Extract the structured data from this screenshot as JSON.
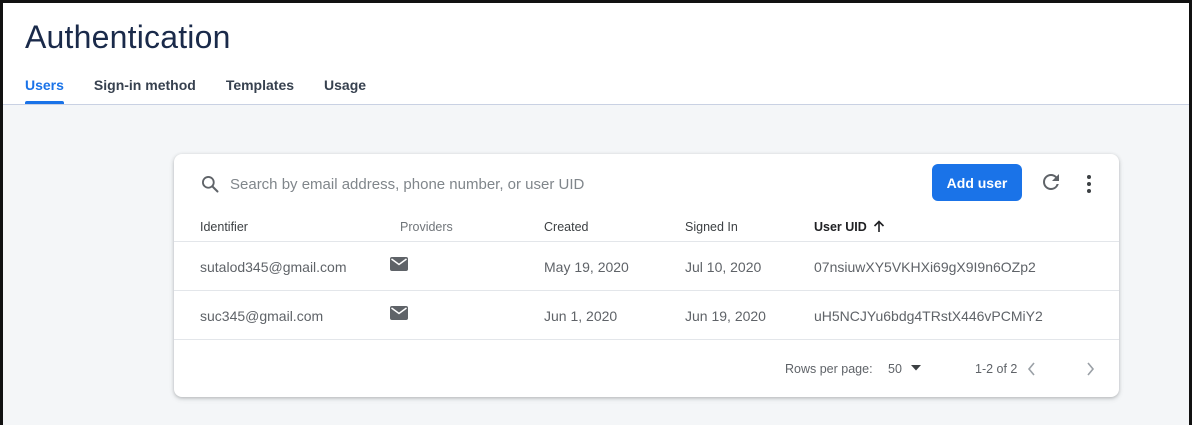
{
  "header": {
    "title": "Authentication",
    "tabs": [
      {
        "label": "Users",
        "active": true
      },
      {
        "label": "Sign-in method",
        "active": false
      },
      {
        "label": "Templates",
        "active": false
      },
      {
        "label": "Usage",
        "active": false
      }
    ]
  },
  "toolbar": {
    "search_placeholder": "Search by email address, phone number, or user UID",
    "add_user_label": "Add user",
    "search_icon": "search-icon",
    "refresh_icon": "refresh-icon",
    "more_icon": "more-vert-icon"
  },
  "table": {
    "columns": [
      "Identifier",
      "Providers",
      "Created",
      "Signed In",
      "User UID"
    ],
    "sort_column": "User UID",
    "sort_direction": "ascending",
    "rows": [
      {
        "identifier": "sutalod345@gmail.com",
        "provider_icon": "mail-icon",
        "created": "May 19, 2020",
        "signed_in": "Jul 10, 2020",
        "uid": "07nsiuwXY5VKHXi69gX9I9n6OZp2"
      },
      {
        "identifier": "suc345@gmail.com",
        "provider_icon": "mail-icon",
        "created": "Jun 1, 2020",
        "signed_in": "Jun 19, 2020",
        "uid": "uH5NCJYu6bdg4TRstX446vPCMiY2"
      }
    ]
  },
  "pagination": {
    "rows_per_page_label": "Rows per page:",
    "rows_per_page_value": "50",
    "range": "1-2 of 2"
  },
  "colors": {
    "accent": "#1a73e8",
    "background": "#f4f6f8",
    "title": "#1a2a4a"
  }
}
